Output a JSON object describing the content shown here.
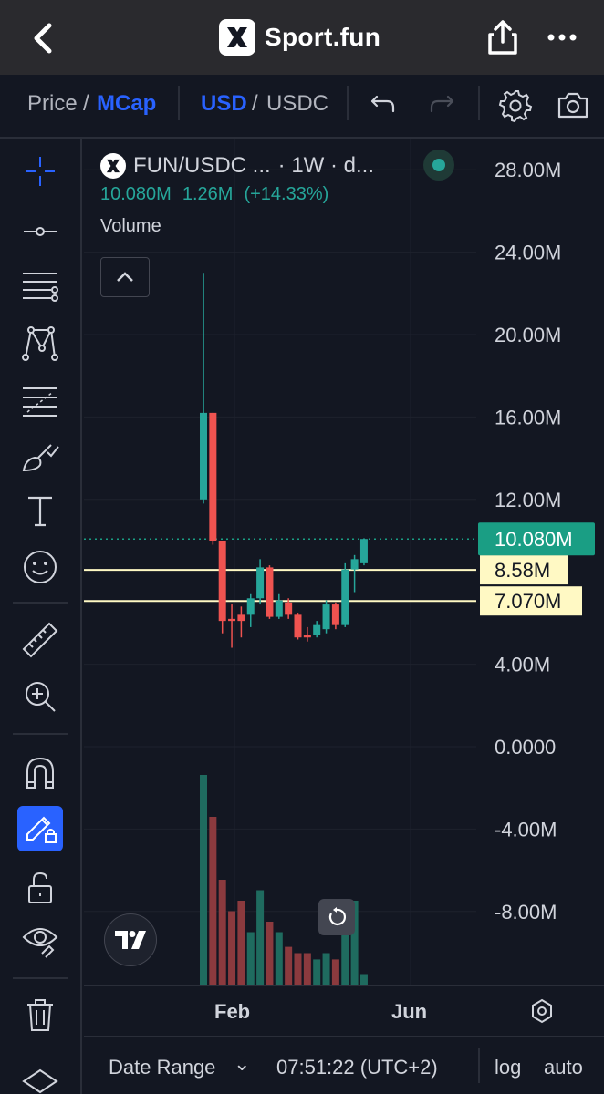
{
  "nav": {
    "title": "Sport.fun",
    "icons": [
      "back-icon",
      "share-icon",
      "more-icon"
    ]
  },
  "toolbar": {
    "price_label": "Price",
    "slash1": "/",
    "mcap_label": "MCap",
    "usd_label": "USD",
    "slash2": "/",
    "usdc_label": "USDC",
    "icons": [
      "undo-icon",
      "redo-icon",
      "settings-icon",
      "camera-icon"
    ]
  },
  "left_tools": [
    "crosshair-icon",
    "horizontal-line-icon",
    "parallel-channel-icon",
    "pattern-icon",
    "fib-icon",
    "brush-icon",
    "text-icon",
    "emoji-icon",
    "ruler-icon",
    "zoom-in-icon",
    "magnet-icon",
    "lock-drawing-icon",
    "unlock-icon",
    "eye-icon",
    "trash-icon",
    "layers-icon"
  ],
  "legend": {
    "symbol": "FUN/USDC ...",
    "interval": "· 1W · d...",
    "last_value": "10.080M",
    "change": "1.26M",
    "change_pct": "(+14.33%)",
    "volume_label": "Volume"
  },
  "chart_data": {
    "type": "candlestick",
    "title": "FUN/USDC",
    "y_ticks": [
      28,
      24,
      20,
      16,
      12,
      4,
      0,
      -4,
      -8
    ],
    "y_tick_labels": [
      "28.00M",
      "24.00M",
      "20.00M",
      "16.00M",
      "12.00M",
      "4.00M",
      "0.0000",
      "-4.00M",
      "-8.00M"
    ],
    "x_tick_labels": [
      "Feb",
      "Jun"
    ],
    "price_tag": {
      "value": 10.08,
      "label": "10.080M",
      "color": "#1a9e84"
    },
    "horizontal_lines": [
      {
        "value": 8.58,
        "label": "8.58M"
      },
      {
        "value": 7.07,
        "label": "7.070M"
      }
    ],
    "candles": [
      {
        "o": 12.0,
        "h": 23.0,
        "l": 11.8,
        "c": 16.2
      },
      {
        "o": 16.2,
        "h": 16.2,
        "l": 9.8,
        "c": 10.0
      },
      {
        "o": 10.0,
        "h": 10.0,
        "l": 5.5,
        "c": 6.1
      },
      {
        "o": 6.2,
        "h": 6.9,
        "l": 4.8,
        "c": 6.1
      },
      {
        "o": 6.4,
        "h": 6.8,
        "l": 5.3,
        "c": 6.1
      },
      {
        "o": 6.4,
        "h": 7.4,
        "l": 5.8,
        "c": 7.2
      },
      {
        "o": 7.2,
        "h": 9.1,
        "l": 6.9,
        "c": 8.7
      },
      {
        "o": 8.7,
        "h": 8.8,
        "l": 6.2,
        "c": 6.3
      },
      {
        "o": 6.3,
        "h": 7.4,
        "l": 6.2,
        "c": 7.1
      },
      {
        "o": 7.0,
        "h": 7.2,
        "l": 6.2,
        "c": 6.4
      },
      {
        "o": 6.4,
        "h": 6.5,
        "l": 5.2,
        "c": 5.3
      },
      {
        "o": 5.4,
        "h": 5.8,
        "l": 5.1,
        "c": 5.3
      },
      {
        "o": 5.4,
        "h": 6.1,
        "l": 5.3,
        "c": 5.9
      },
      {
        "o": 5.7,
        "h": 7.1,
        "l": 5.5,
        "c": 6.9
      },
      {
        "o": 6.9,
        "h": 7.0,
        "l": 5.7,
        "c": 5.9
      },
      {
        "o": 5.9,
        "h": 8.9,
        "l": 5.8,
        "c": 8.6
      },
      {
        "o": 8.6,
        "h": 9.3,
        "l": 7.5,
        "c": 9.1
      },
      {
        "o": 8.9,
        "h": 10.1,
        "l": 8.8,
        "c": 10.08
      }
    ],
    "volumes": [
      100,
      80,
      50,
      35,
      40,
      25,
      45,
      30,
      25,
      18,
      15,
      15,
      12,
      15,
      12,
      30,
      40,
      5
    ],
    "colors": {
      "up": "#26a69a",
      "down": "#ef5350",
      "vol_up": "#1f6b5f",
      "vol_down": "#8b3a3e",
      "line": "#fff9c4"
    }
  },
  "time_axis": {
    "feb": "Feb",
    "jun": "Jun"
  },
  "bottom": {
    "date_range": "Date Range",
    "chevron": "⌄",
    "time": "07:51:22 (UTC+2)",
    "log": "log",
    "auto": "auto"
  }
}
